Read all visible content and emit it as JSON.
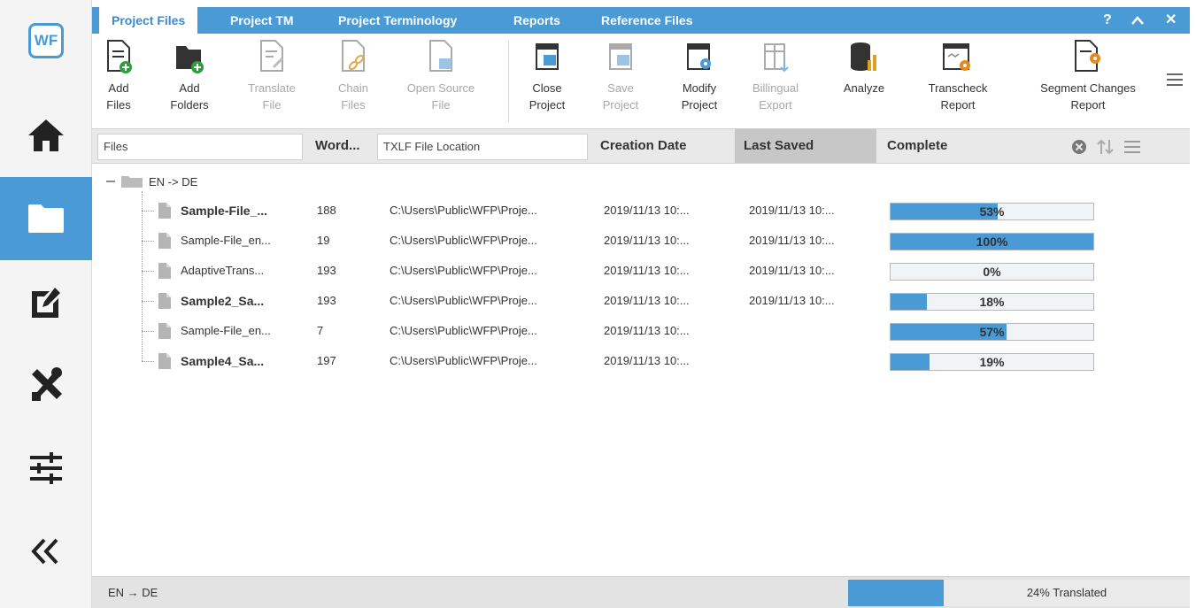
{
  "sidebar": {
    "logo": "WF",
    "items": [
      "home-icon",
      "projects-folder-icon",
      "edit-icon",
      "tools-icon",
      "settings-sliders-icon",
      "collapse-icon"
    ]
  },
  "tabs": [
    {
      "label": "Project Files",
      "active": true
    },
    {
      "label": "Project TM"
    },
    {
      "label": "Project Terminology"
    },
    {
      "label": "Reports"
    },
    {
      "label": "Reference Files"
    }
  ],
  "window_controls": {
    "help": "?",
    "collapse": "^",
    "close": "✕"
  },
  "ribbon": {
    "add_files": "Add\nFiles",
    "add_folders": "Add\nFolders",
    "translate_file": "Translate\nFile",
    "chain_files": "Chain\nFiles",
    "open_source_file": "Open Source\nFile",
    "close_project": "Close\nProject",
    "save_project": "Save\nProject",
    "modify_project": "Modify\nProject",
    "bilingual_export": "Billingual\nExport",
    "analyze": "Analyze",
    "transcheck_report": "Transcheck\nReport",
    "segment_changes_report": "Segment Changes\nReport"
  },
  "columns": {
    "files_filter": "Files",
    "words": "Word...",
    "location_filter": "TXLF File Location",
    "creation_date": "Creation Date",
    "last_saved": "Last Saved",
    "complete": "Complete"
  },
  "tree": {
    "group_label": "EN -> DE",
    "rows": [
      {
        "name": "Sample-File_...",
        "bold": true,
        "words": "188",
        "location": "C:\\Users\\Public\\WFP\\Proje...",
        "created": "2019/11/13 10:...",
        "saved": "2019/11/13 10:...",
        "percent": "53%",
        "value": 0.53
      },
      {
        "name": "Sample-File_en...",
        "bold": false,
        "words": "19",
        "location": "C:\\Users\\Public\\WFP\\Proje...",
        "created": "2019/11/13 10:...",
        "saved": "2019/11/13 10:...",
        "percent": "100%",
        "value": 1.0
      },
      {
        "name": "AdaptiveTrans...",
        "bold": false,
        "words": "193",
        "location": "C:\\Users\\Public\\WFP\\Proje...",
        "created": "2019/11/13 10:...",
        "saved": "2019/11/13 10:...",
        "percent": "0%",
        "value": 0.0
      },
      {
        "name": "Sample2_Sa...",
        "bold": true,
        "words": "193",
        "location": "C:\\Users\\Public\\WFP\\Proje...",
        "created": "2019/11/13 10:...",
        "saved": "2019/11/13 10:...",
        "percent": "18%",
        "value": 0.18
      },
      {
        "name": "Sample-File_en...",
        "bold": false,
        "words": "7",
        "location": "C:\\Users\\Public\\WFP\\Proje...",
        "created": "2019/11/13 10:...",
        "saved": "",
        "percent": "57%",
        "value": 0.57
      },
      {
        "name": "Sample4_Sa...",
        "bold": true,
        "words": "197",
        "location": "C:\\Users\\Public\\WFP\\Proje...",
        "created": "2019/11/13 10:...",
        "saved": "",
        "percent": "19%",
        "value": 0.19
      }
    ]
  },
  "status": {
    "language": "EN → DE",
    "translated": "24% Translated",
    "value": 0.24
  },
  "colors": {
    "accent": "#4a9ad6",
    "sidebar_active": "#4a9ad6",
    "header_bg": "#e9e9e9",
    "sorted_col": "#c7c7c7"
  }
}
